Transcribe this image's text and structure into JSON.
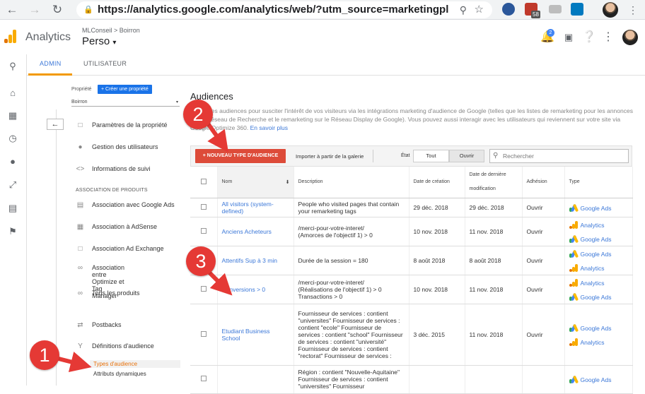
{
  "browser": {
    "url": "https://analytics.google.com/analytics/web/?utm_source=marketingpl",
    "ext_badge": "58"
  },
  "header": {
    "app_title": "Analytics",
    "breadcrumb": "MLConseil > Boirron",
    "view_name": "Perso",
    "notif_count": "2"
  },
  "tabs": {
    "admin": "ADMIN",
    "user": "UTILISATEUR"
  },
  "property": {
    "label": "Propriété",
    "create_button": "Créer une propriété",
    "selected": "Boirron"
  },
  "nav": {
    "back": "←",
    "items": [
      {
        "label": "Paramètres de la propriété"
      },
      {
        "label": "Gestion des utilisateurs"
      },
      {
        "label": "Informations de suivi"
      }
    ],
    "assoc_heading": "ASSOCIATION DE PRODUITS",
    "assoc_items": [
      {
        "label": "Association avec Google Ads"
      },
      {
        "label": "Association à AdSense"
      },
      {
        "label": "Association Ad Exchange"
      },
      {
        "label": "Association entre Optimize et\nTag Manager"
      },
      {
        "label": "Tous les produits"
      }
    ],
    "postbacks": "Postbacks",
    "audience_defs": "Définitions d'audience",
    "sub_types": "Types d'audience",
    "sub_dynamic": "Attributs dynamiques"
  },
  "main": {
    "title": "Audiences",
    "description": "Créez des audiences pour susciter l'intérêt de vos visiteurs via les intégrations marketing d'audience de Google (telles que les listes de remarketing pour les annonces sur le Réseau de Recherche et le remarketing sur le Réseau Display de Google). Vous pouvez aussi interagir avec les utilisateurs qui reviennent sur votre site via Google Optimize 360.",
    "learn_more": "En savoir plus",
    "new_audience_button": "+ NOUVEAU TYPE D'AUDIENCE",
    "import_link": "Importer à partir de la galerie",
    "state_label": "État",
    "filter_all": "Tout",
    "filter_open": "Ouvrir",
    "search_placeholder": "Rechercher"
  },
  "table": {
    "headers": {
      "name": "Nom",
      "description": "Description",
      "created": "Date de création",
      "modified": "Date de dernière\nmodification",
      "adhesion": "Adhésion",
      "type": "Type"
    },
    "rows": [
      {
        "name": "All visitors (system-defined)",
        "description": "People who visited pages that contain your remarketing tags",
        "created": "29 déc. 2018",
        "modified": "29 déc. 2018",
        "adhesion": "Ouvrir",
        "types": [
          "Google Ads"
        ]
      },
      {
        "name": "Anciens Acheteurs",
        "description": "/merci-pour-votre-interet/\n(Amorces de l'objectif 1) > 0",
        "created": "10 nov. 2018",
        "modified": "11 nov. 2018",
        "adhesion": "Ouvrir",
        "types": [
          "Analytics",
          "Google Ads"
        ]
      },
      {
        "name": "Attentifs Sup à 3 min",
        "description": "Durée de la session = 180",
        "created": "8 août 2018",
        "modified": "8 août 2018",
        "adhesion": "Ouvrir",
        "types": [
          "Google Ads",
          "Analytics"
        ]
      },
      {
        "name": "Conversions > 0",
        "description": "/merci-pour-votre-interet/\n(Réalisations de l'objectif 1) > 0\nTransactions > 0",
        "created": "10 nov. 2018",
        "modified": "11 nov. 2018",
        "adhesion": "Ouvrir",
        "types": [
          "Analytics",
          "Google Ads"
        ]
      },
      {
        "name": "Etudiant Business School",
        "description": "Fournisseur de services : contient \"universites\" Fournisseur de services : contient \"ecole\" Fournisseur de services : contient \"school\" Fournisseur de services : contient \"université\" Fournisseur de services : contient \"rectorat\" Fournisseur de services :",
        "created": "3 déc. 2015",
        "modified": "11 nov. 2018",
        "adhesion": "Ouvrir",
        "types": [
          "Google Ads",
          "Analytics"
        ]
      },
      {
        "name": "",
        "description": "Région : contient \"Nouvelle-Aquitaine\" Fournisseur de services : contient \"universites\" Fournisseur",
        "created": "",
        "modified": "",
        "adhesion": "",
        "types": [
          "Google Ads"
        ]
      }
    ]
  },
  "callouts": [
    "1",
    "2",
    "3"
  ],
  "colors": {
    "accent_blue": "#3c78d8",
    "cta_red": "#dd4b39",
    "callout_red": "#e53935",
    "tab_underline": "#f29900"
  }
}
